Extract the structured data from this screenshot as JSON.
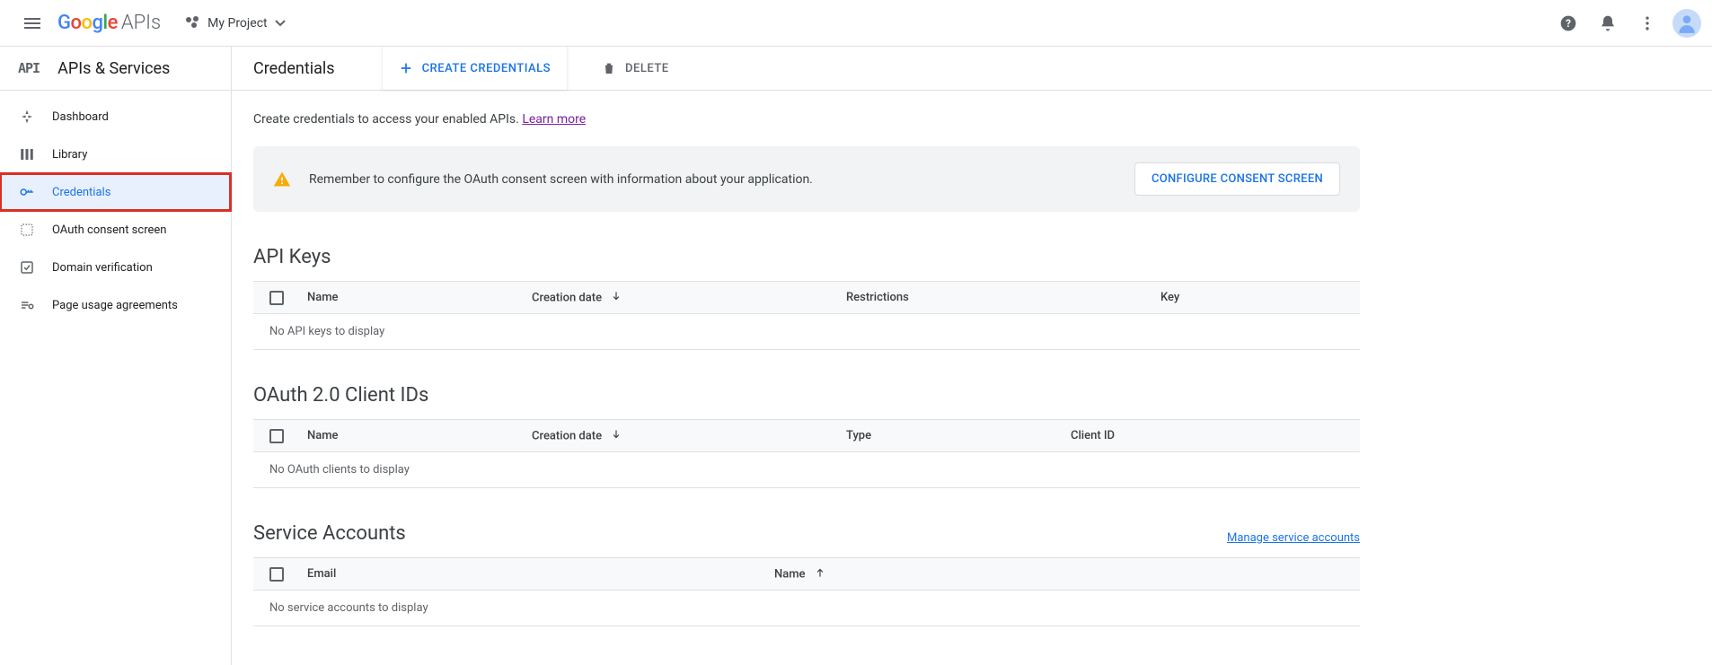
{
  "topbar": {
    "logo_apis": "APIs",
    "project_name": "My Project"
  },
  "sidebar": {
    "title": "APIs & Services",
    "api_abbr": "API",
    "items": [
      {
        "label": "Dashboard"
      },
      {
        "label": "Library"
      },
      {
        "label": "Credentials"
      },
      {
        "label": "OAuth consent screen"
      },
      {
        "label": "Domain verification"
      },
      {
        "label": "Page usage agreements"
      }
    ]
  },
  "header": {
    "title": "Credentials",
    "create_label": "CREATE CREDENTIALS",
    "delete_label": "DELETE"
  },
  "intro": {
    "text": "Create credentials to access your enabled APIs. ",
    "link": "Learn more"
  },
  "banner": {
    "text": "Remember to configure the OAuth consent screen with information about your application.",
    "button": "CONFIGURE CONSENT SCREEN"
  },
  "sections": {
    "apikeys": {
      "title": "API Keys",
      "cols": {
        "name": "Name",
        "created": "Creation date",
        "restrictions": "Restrictions",
        "key": "Key"
      },
      "empty": "No API keys to display"
    },
    "oauth": {
      "title": "OAuth 2.0 Client IDs",
      "cols": {
        "name": "Name",
        "created": "Creation date",
        "type": "Type",
        "clientid": "Client ID"
      },
      "empty": "No OAuth clients to display"
    },
    "svc": {
      "title": "Service Accounts",
      "manage_link": "Manage service accounts",
      "cols": {
        "email": "Email",
        "name": "Name"
      },
      "empty": "No service accounts to display"
    }
  }
}
